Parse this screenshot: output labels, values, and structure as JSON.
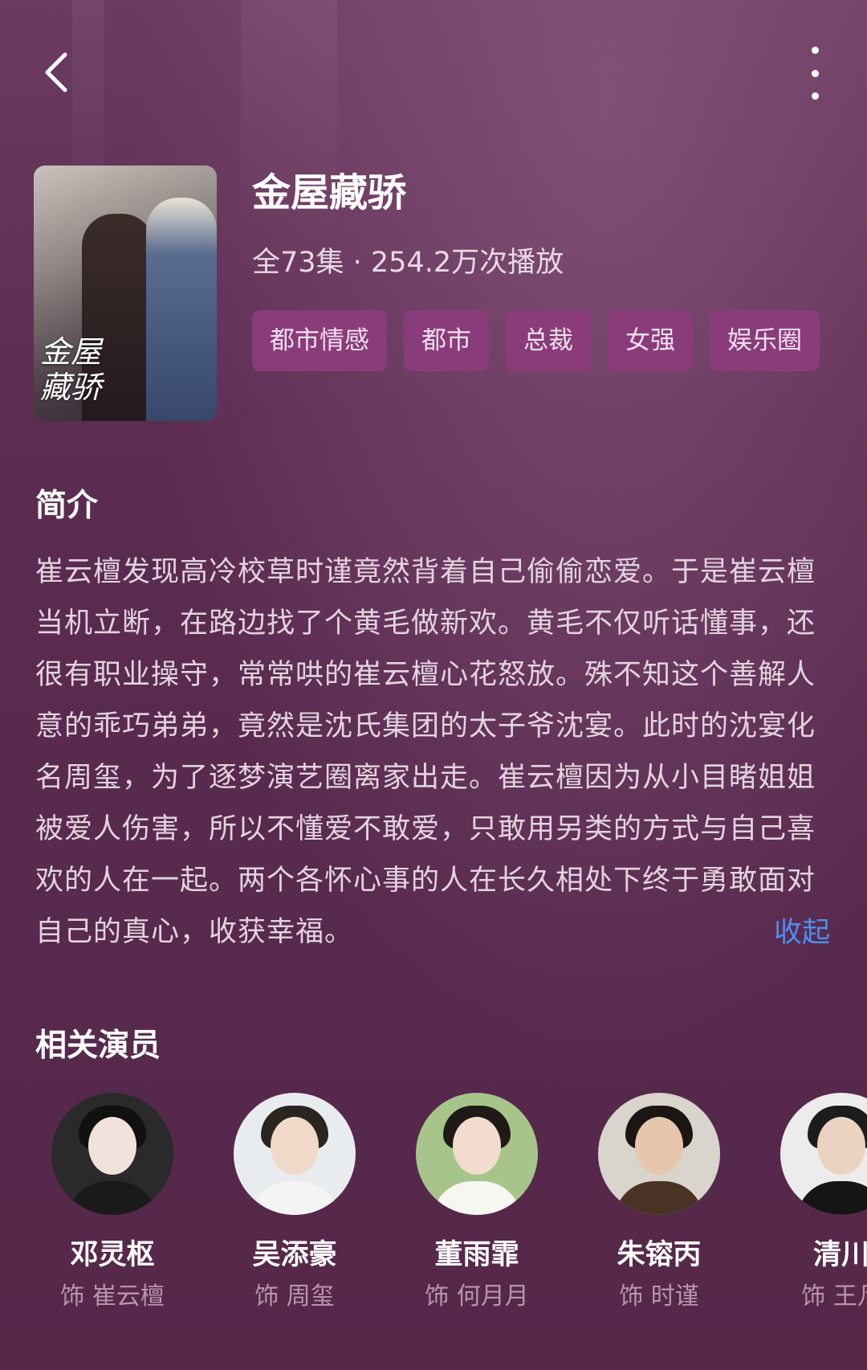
{
  "header": {
    "back_icon": "chevron-left-icon",
    "more_icon": "more-vertical-icon"
  },
  "drama": {
    "poster_title": "金屋藏骄",
    "title": "金屋藏骄",
    "meta": "全73集 · 254.2万次播放",
    "tags": [
      "都市情感",
      "都市",
      "总裁",
      "女强",
      "娱乐圈"
    ]
  },
  "intro": {
    "heading": "简介",
    "text": "崔云檀发现高冷校草时谨竟然背着自己偷偷恋爱。于是崔云檀当机立断，在路边找了个黄毛做新欢。黄毛不仅听话懂事，还很有职业操守，常常哄的崔云檀心花怒放。殊不知这个善解人意的乖巧弟弟，竟然是沈氏集团的太子爷沈宴。此时的沈宴化名周玺，为了逐梦演艺圈离家出走。崔云檀因为从小目睹姐姐被爱人伤害，所以不懂爱不敢爱，只敢用另类的方式与自己喜欢的人在一起。两个各怀心事的人在长久相处下终于勇敢面对自己的真心，收获幸福。",
    "collapse_label": "收起"
  },
  "cast": {
    "heading": "相关演员",
    "actors": [
      {
        "name": "邓灵枢",
        "role": "饰 崔云檀"
      },
      {
        "name": "吴添豪",
        "role": "饰 周玺"
      },
      {
        "name": "董雨霏",
        "role": "饰 何月月"
      },
      {
        "name": "朱镕丙",
        "role": "饰 时谨"
      },
      {
        "name": "清川",
        "role": "饰 王凡"
      }
    ]
  },
  "colors": {
    "background": "#5a2a4f",
    "tag_bg": "#8a3c7a",
    "link": "#4b8ff0",
    "role_text": "#b995ae"
  }
}
